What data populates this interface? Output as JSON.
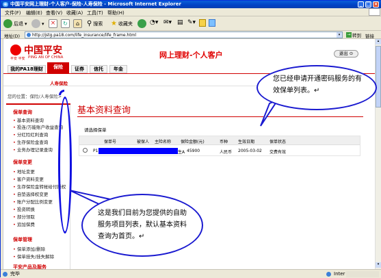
{
  "window": {
    "title": "中国平安网上理财-个人客户-保险-人寿保险 - Microsoft Internet Explorer"
  },
  "menu": [
    "文件(F)",
    "编辑(E)",
    "查看(V)",
    "收藏(A)",
    "工具(T)",
    "帮助(H)"
  ],
  "toolbar": {
    "back": "后退",
    "search": "搜索",
    "favorites": "收藏夹"
  },
  "address": {
    "label": "地址(D)",
    "url": "http://jstg.pa18.com/life_insurance/life_frame.html",
    "go": "转到",
    "links": "链接"
  },
  "site": {
    "logo_main": "中国平安",
    "logo_sub": "PING AN OF CHINA",
    "logo_small": "平安 平安",
    "header_title": "网上理财-个人客户",
    "logout": "退出",
    "tabs": [
      "我的PA18理财",
      "保险",
      "证券",
      "信托",
      "年金"
    ],
    "subnav": "人寿保险",
    "breadcrumb": "您的位置：保险/人寿保险>"
  },
  "sidebar": {
    "sections": [
      {
        "title": "保单查询",
        "items": [
          "基本资料查询",
          "投连/万能账户收益查询",
          "分红险红利查询",
          "生存保险金查询",
          "业务办理记录查询"
        ]
      },
      {
        "title": "保单变更",
        "items": [
          "地址变更",
          "客户资料变更",
          "生存保险金转帐给付授权",
          "自垫选择权变更",
          "账户分配比例变更",
          "投资转换",
          "部分领取",
          "追加保费"
        ]
      },
      {
        "title": "保单管理",
        "items": [
          "保单添加/删除",
          "保单挂失/挂失解除"
        ]
      },
      {
        "title": "平安产品及服务",
        "items": []
      }
    ]
  },
  "main": {
    "title": "基本资料查询",
    "select_label": "请选择保单",
    "table": {
      "headers": [
        "保单号",
        "被保人",
        "主险名称",
        "保险金额(元)",
        "币种",
        "生效日期",
        "保单状态"
      ],
      "rows": [
        {
          "policy_no": "P1",
          "insured": "",
          "product": "生A",
          "amount": "45900",
          "currency": "人民币",
          "date": "2005-03-02",
          "status": "交费有效"
        }
      ]
    }
  },
  "callouts": {
    "top": "您已经申请开通密码服务的有效保单列表。↵",
    "bottom": "这是我们目前为您提供的自助服务项目列表，默认基本资料查询为首页。↵"
  },
  "status": {
    "left": "完毕",
    "zone": "Inter"
  },
  "colors": {
    "brand_red": "#d00000",
    "redact_blue": "#0000ff",
    "callout_border": "#1a1ad0"
  }
}
